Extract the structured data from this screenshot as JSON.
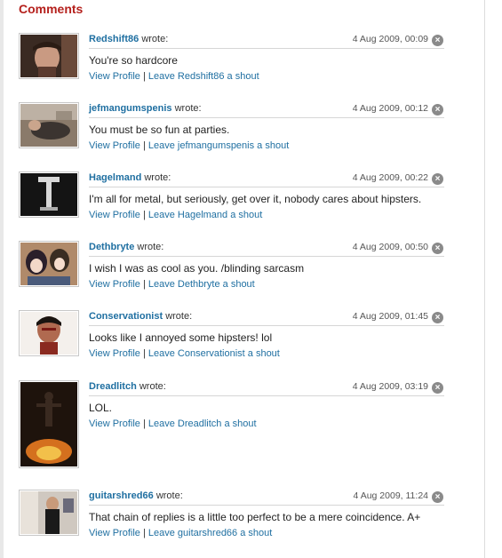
{
  "page": {
    "heading": "Comments"
  },
  "labels": {
    "wrote": "wrote:",
    "view_profile": "View Profile",
    "separator": "|"
  },
  "colors": {
    "heading": "#b5211d",
    "link": "#1f6fa1"
  },
  "comments": [
    {
      "author": "Redshift86",
      "date": "4 Aug 2009, 00:09",
      "text": "You're so hardcore",
      "shout": "Leave Redshift86 a shout",
      "avatar": "man-face-photo"
    },
    {
      "author": "jefmangumspenis",
      "date": "4 Aug 2009, 00:12",
      "text": "You must be so fun at parties.",
      "shout": "Leave jefmangumspenis a shout",
      "avatar": "person-lying-photo"
    },
    {
      "author": "Hagelmand",
      "date": "4 Aug 2009, 00:22",
      "text": "I'm all for metal, but seriously, get over it, nobody cares about hipsters.",
      "shout": "Leave Hagelmand a shout",
      "avatar": "hammer-silhouette-photo"
    },
    {
      "author": "Dethbryte",
      "date": "4 Aug 2009, 00:50",
      "text": "I wish I was as cool as you. /blinding sarcasm",
      "shout": "Leave Dethbryte a shout",
      "avatar": "anime-characters-image"
    },
    {
      "author": "Conservationist",
      "date": "4 Aug 2009, 01:45",
      "text": "Looks like I annoyed some hipsters! lol",
      "shout": "Leave Conservationist a shout",
      "avatar": "bloody-face-image"
    },
    {
      "author": "Dreadlitch",
      "date": "4 Aug 2009, 03:19",
      "text": "LOL.",
      "shout": "Leave Dreadlitch a shout",
      "avatar": "dark-fire-figure-photo"
    },
    {
      "author": "guitarshred66",
      "date": "4 Aug 2009, 11:24",
      "text": "That chain of replies is a little too perfect to be a mere coincidence. A+",
      "shout": "Leave guitarshred66 a shout",
      "avatar": "person-in-room-photo"
    }
  ]
}
